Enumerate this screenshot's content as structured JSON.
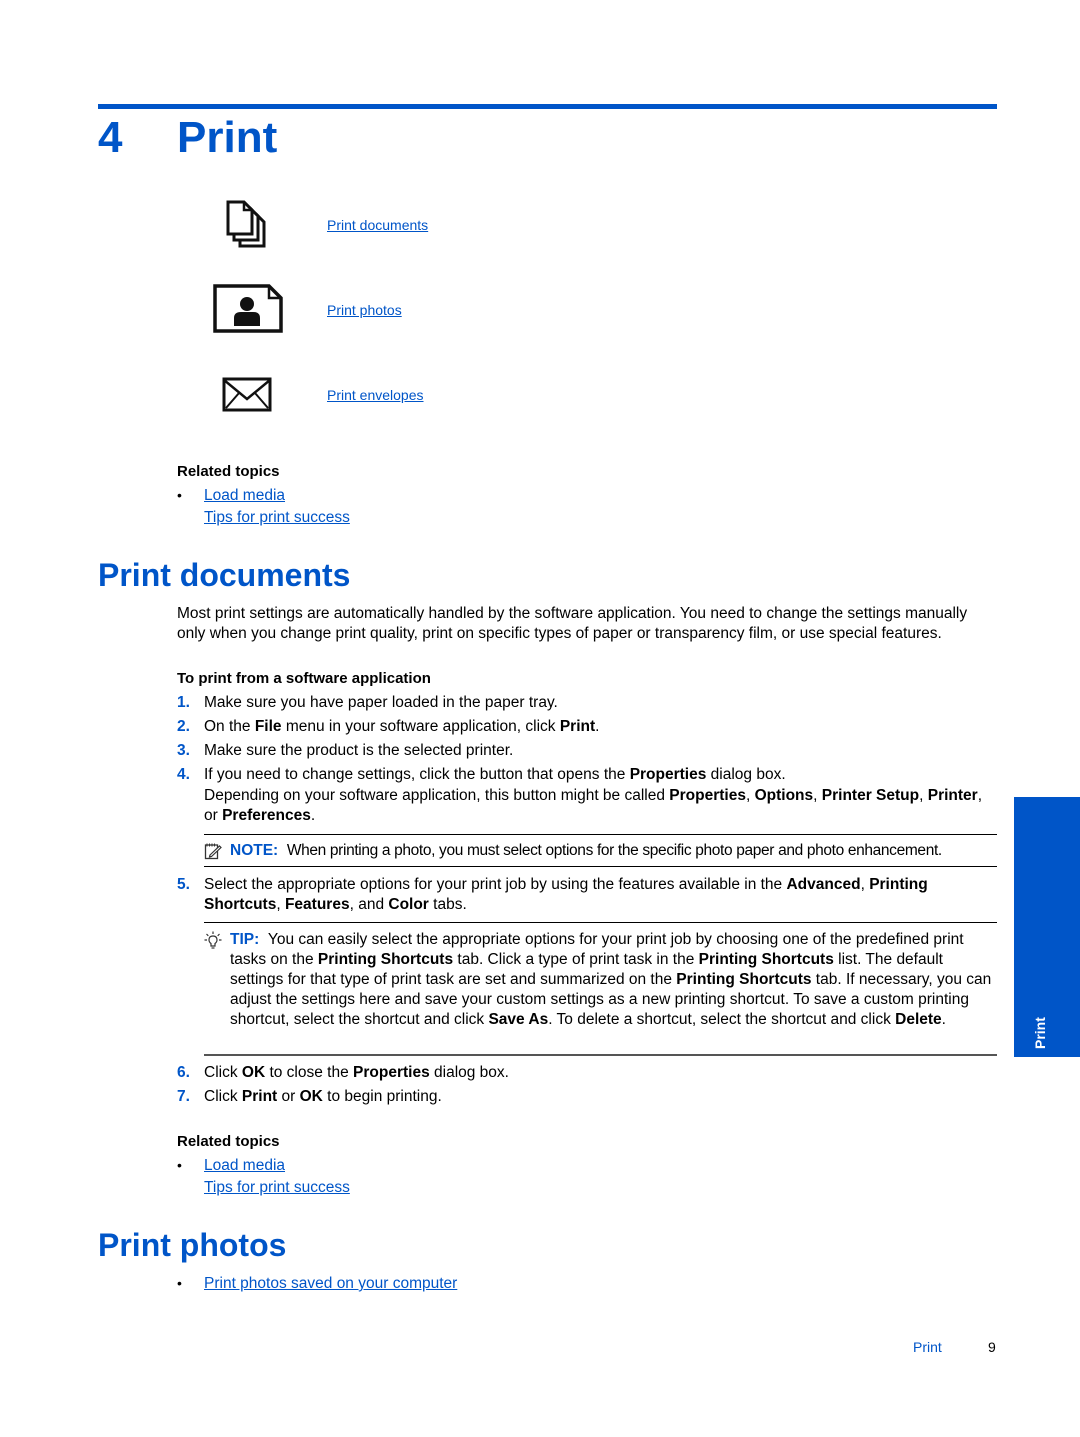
{
  "chapter": {
    "number": "4",
    "title": "Print"
  },
  "toc": [
    {
      "icon": "documents-icon",
      "label": "Print documents"
    },
    {
      "icon": "photo-icon",
      "label": "Print photos"
    },
    {
      "icon": "envelope-icon",
      "label": "Print envelopes"
    }
  ],
  "related_top": {
    "heading": "Related topics",
    "bullet": "•",
    "links": [
      "Load media",
      "Tips for print success"
    ]
  },
  "print_documents": {
    "title": "Print documents",
    "intro": "Most print settings are automatically handled by the software application. You need to change the settings manually only when you change print quality, print on specific types of paper or transparency film, or use special features.",
    "procedure_title": "To print from a software application",
    "steps": [
      {
        "num": "1.",
        "parts": [
          [
            "Make sure you have paper loaded in the paper tray.",
            false
          ]
        ]
      },
      {
        "num": "2.",
        "parts": [
          [
            "On the ",
            false
          ],
          [
            "File",
            true
          ],
          [
            " menu in your software application, click ",
            false
          ],
          [
            "Print",
            true
          ],
          [
            ".",
            false
          ]
        ]
      },
      {
        "num": "3.",
        "parts": [
          [
            "Make sure the product is the selected printer.",
            false
          ]
        ]
      },
      {
        "num": "4.",
        "parts": [
          [
            "If you need to change settings, click the button that opens the ",
            false
          ],
          [
            "Properties",
            true
          ],
          [
            " dialog box.",
            false
          ]
        ]
      },
      {
        "num": "",
        "parts": [
          [
            "Depending on your software application, this button might be called ",
            false
          ],
          [
            "Properties",
            true
          ],
          [
            ", ",
            false
          ],
          [
            "Options",
            true
          ],
          [
            ", ",
            false
          ],
          [
            "Printer Setup",
            true
          ],
          [
            ", ",
            false
          ],
          [
            "Printer",
            true
          ],
          [
            ", or ",
            false
          ],
          [
            "Preferences",
            true
          ],
          [
            ".",
            false
          ]
        ]
      },
      {
        "num": "5.",
        "parts": [
          [
            "Select the appropriate options for your print job by using the features available in the ",
            false
          ],
          [
            "Advanced",
            true
          ],
          [
            ", ",
            false
          ],
          [
            "Printing Shortcuts",
            true
          ],
          [
            ", ",
            false
          ],
          [
            "Features",
            true
          ],
          [
            ", and ",
            false
          ],
          [
            "Color",
            true
          ],
          [
            " tabs.",
            false
          ]
        ]
      },
      {
        "num": "6.",
        "parts": [
          [
            "Click ",
            false
          ],
          [
            "OK",
            true
          ],
          [
            " to close the ",
            false
          ],
          [
            "Properties",
            true
          ],
          [
            " dialog box.",
            false
          ]
        ]
      },
      {
        "num": "7.",
        "parts": [
          [
            "Click ",
            false
          ],
          [
            "Print",
            true
          ],
          [
            " or ",
            false
          ],
          [
            "OK",
            true
          ],
          [
            " to begin printing.",
            false
          ]
        ]
      }
    ],
    "note": {
      "label": "NOTE:",
      "icon": "note-pencil-icon",
      "parts": [
        [
          "When printing a photo, you must select options for the specific photo paper and photo enhancement.",
          false
        ]
      ]
    },
    "tip": {
      "label": "TIP:",
      "icon": "lightbulb-icon",
      "parts": [
        [
          "You can easily select the appropriate options for your print job by choosing one of the predefined print tasks on the ",
          false
        ],
        [
          "Printing Shortcuts",
          true
        ],
        [
          " tab. Click a type of print task in the ",
          false
        ],
        [
          "Printing Shortcuts",
          true
        ],
        [
          " list. The default settings for that type of print task are set and summarized on the ",
          false
        ],
        [
          "Printing Shortcuts",
          true
        ],
        [
          " tab. If necessary, you can adjust the settings here and save your custom settings as a new printing shortcut. To save a custom printing shortcut, select the shortcut and click ",
          false
        ],
        [
          "Save As",
          true
        ],
        [
          ". To delete a shortcut, select the shortcut and click ",
          false
        ],
        [
          "Delete",
          true
        ],
        [
          ".",
          false
        ]
      ]
    },
    "related": {
      "heading": "Related topics",
      "bullet": "•",
      "links": [
        "Load media",
        "Tips for print success"
      ]
    }
  },
  "print_photos": {
    "title": "Print photos",
    "bullet": "•",
    "links": [
      "Print photos saved on your computer"
    ]
  },
  "side_tab": {
    "label": "Print"
  },
  "footer": {
    "section": "Print",
    "page": "9"
  },
  "colors": {
    "accent": "#0055c8"
  }
}
